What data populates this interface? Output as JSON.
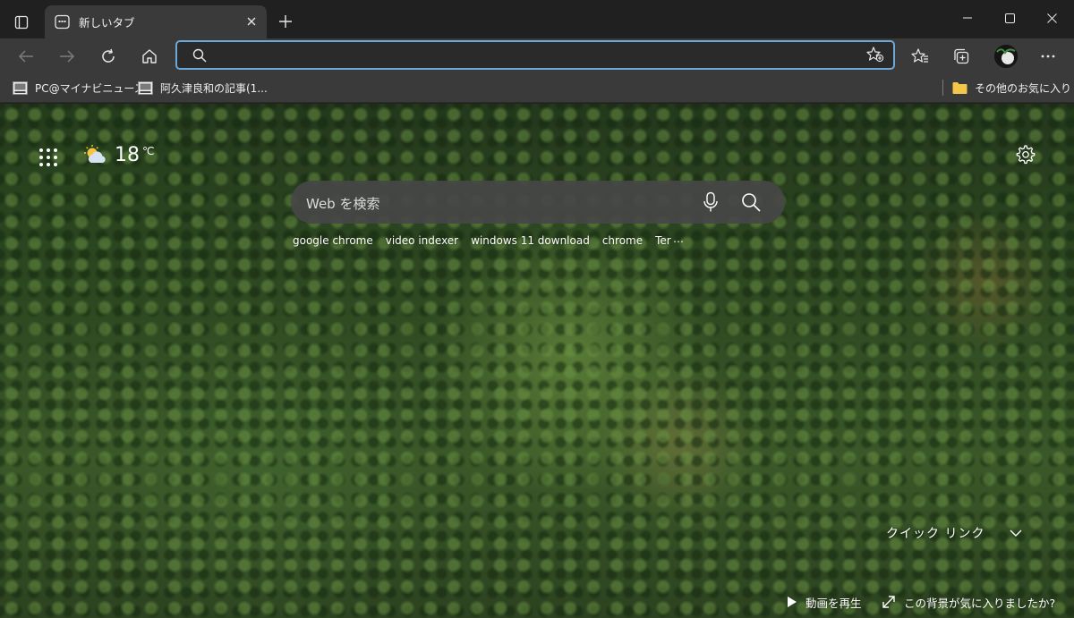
{
  "tab": {
    "title": "新しいタブ"
  },
  "address_bar": {
    "value": "",
    "placeholder": ""
  },
  "favorites": [
    {
      "label": "PC@マイナビニュース",
      "icon": "site-favicon"
    },
    {
      "label": "阿久津良和の記事(1...",
      "icon": "site-favicon"
    }
  ],
  "other_favorites": {
    "label": "その他のお気に入り",
    "icon": "folder-icon"
  },
  "weather": {
    "temperature": "18",
    "unit": "℃",
    "icon": "partly-cloudy-icon"
  },
  "search": {
    "placeholder": "Web を検索"
  },
  "trending": [
    "google chrome",
    "video indexer",
    "windows 11 download",
    "chrome",
    "Ter"
  ],
  "trending_more": "…",
  "quick_links": {
    "label": "クイック リンク"
  },
  "footer": {
    "play_video": "動画を再生",
    "like_background": "この背景が気に入りましたか?"
  },
  "colors": {
    "accent_focus": "#6ea8d8",
    "toolbar": "#3a3a3a",
    "titlebar": "#202020"
  }
}
